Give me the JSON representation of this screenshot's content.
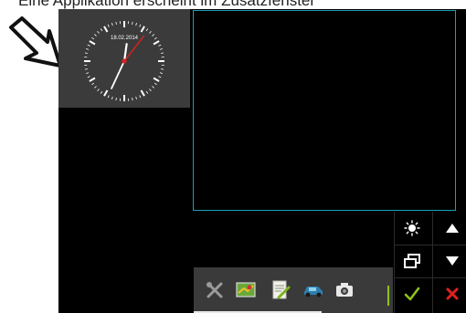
{
  "caption": {
    "text": "Eine Applikation erscheint im Zusatzfenster"
  },
  "clock": {
    "date": "18.02.2014",
    "hour_hand_deg": 8,
    "minute_hand_deg": 205,
    "second_hand_deg": 38
  },
  "colors": {
    "window_border": "#1aa0b4",
    "accept": "#8fc21a",
    "close": "#e02020"
  },
  "controls": [
    {
      "name": "brightness-icon"
    },
    {
      "name": "scroll-up-icon"
    },
    {
      "name": "window-switch-icon"
    },
    {
      "name": "scroll-down-icon"
    },
    {
      "name": "accept-icon"
    },
    {
      "name": "close-icon"
    }
  ],
  "taskbar": {
    "items": [
      {
        "name": "tools-icon"
      },
      {
        "name": "map-icon"
      },
      {
        "name": "notes-icon"
      },
      {
        "name": "car-icon"
      },
      {
        "name": "camera-icon"
      }
    ]
  }
}
